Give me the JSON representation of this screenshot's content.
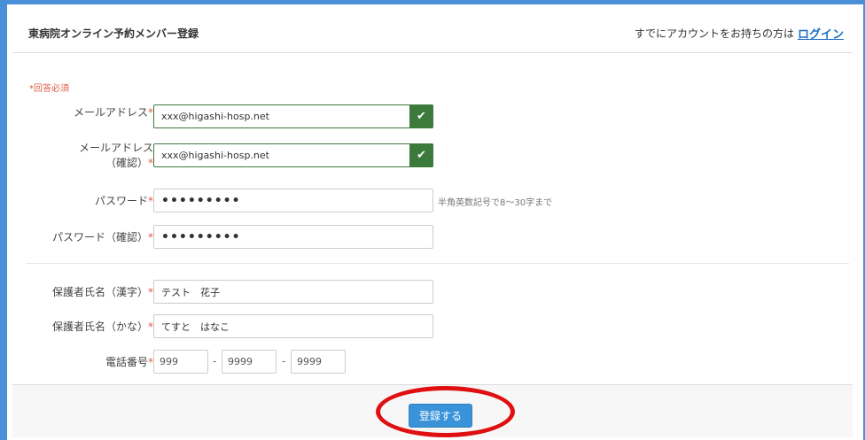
{
  "header": {
    "title": "東病院オンライン予約メンバー登録",
    "login_prompt": "すでにアカウントをお持ちの方は",
    "login_link": "ログイン"
  },
  "required_note": "*回答必須",
  "required_mark": "*",
  "fields": {
    "email": {
      "label": "メールアドレス",
      "value": "xxx@higashi-hosp.net"
    },
    "email_confirm": {
      "label_line1": "メールアドレス",
      "label_line2": "（確認）",
      "value": "xxx@higashi-hosp.net"
    },
    "password": {
      "label": "パスワード",
      "value": "•••••••••",
      "hint": "半角英数記号で8～30字まで"
    },
    "password_confirm": {
      "label": "パスワード（確認）",
      "value": "•••••••••"
    },
    "guardian_kanji": {
      "label": "保護者氏名（漢字）",
      "value": "テスト　花子"
    },
    "guardian_kana": {
      "label": "保護者氏名（かな）",
      "value": "てすと　はなこ"
    },
    "phone": {
      "label": "電話番号",
      "part1": "999",
      "part2": "9999",
      "part3": "9999",
      "separator": "-"
    }
  },
  "valid_check_icon": "✔",
  "submit_label": "登録する",
  "colors": {
    "frame": "#4a90d9",
    "required": "#e05a47",
    "valid": "#3c7a3c",
    "submit": "#3a93d8",
    "highlight": "#e01010"
  }
}
